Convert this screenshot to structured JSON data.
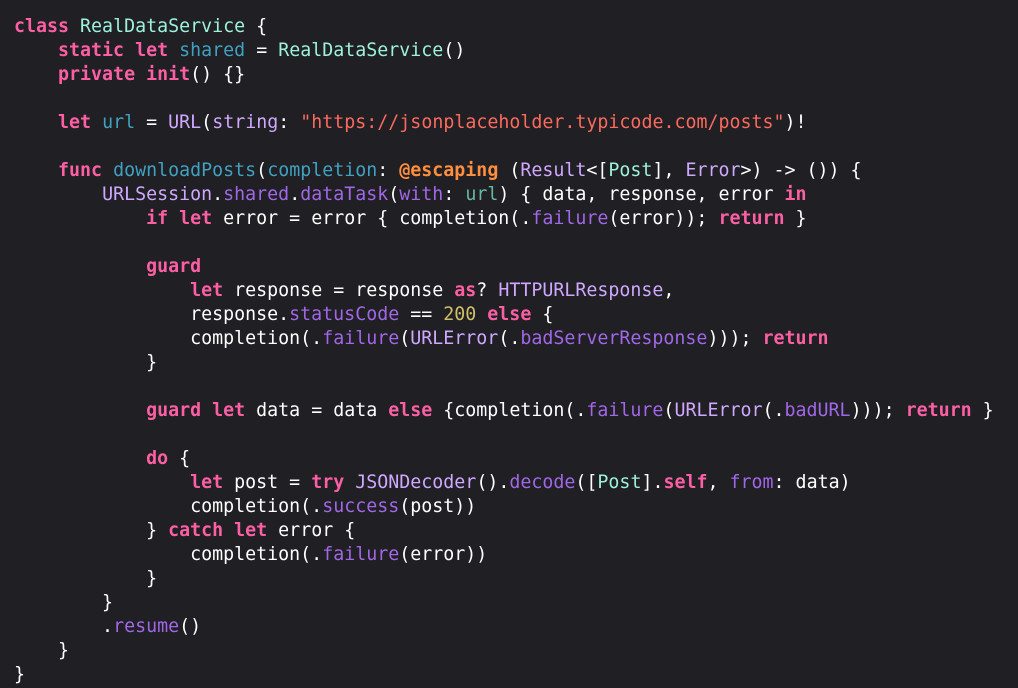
{
  "theme": {
    "background": "#1f1f24",
    "plain": "#ffffff",
    "keyword": "#fc5fa3",
    "string": "#fc6a5d",
    "number": "#d0bf69",
    "type_name": "#d0a8ff",
    "declaration": "#41a1c0",
    "project_member": "#a167e6",
    "class_name": "#9ef1dd",
    "attribute": "#fd8f3f"
  },
  "code_lines": [
    [
      [
        "kw",
        "class"
      ],
      [
        "pl",
        " "
      ],
      [
        "clsname",
        "RealDataService"
      ],
      [
        "pl",
        " {"
      ]
    ],
    [
      [
        "pl",
        "    "
      ],
      [
        "kw",
        "static"
      ],
      [
        "pl",
        " "
      ],
      [
        "kw",
        "let"
      ],
      [
        "pl",
        " "
      ],
      [
        "decl",
        "shared"
      ],
      [
        "pl",
        " = "
      ],
      [
        "clsname",
        "RealDataService"
      ],
      [
        "pl",
        "()"
      ]
    ],
    [
      [
        "pl",
        "    "
      ],
      [
        "kw",
        "private"
      ],
      [
        "pl",
        " "
      ],
      [
        "kw",
        "init"
      ],
      [
        "pl",
        "() {}"
      ]
    ],
    [
      [
        "pl",
        ""
      ]
    ],
    [
      [
        "pl",
        "    "
      ],
      [
        "kw",
        "let"
      ],
      [
        "pl",
        " "
      ],
      [
        "decl",
        "url"
      ],
      [
        "pl",
        " = "
      ],
      [
        "typ",
        "URL"
      ],
      [
        "pl",
        "("
      ],
      [
        "typ",
        "string"
      ],
      [
        "pl",
        ": "
      ],
      [
        "str",
        "\"https://jsonplaceholder.typicode.com/posts\""
      ],
      [
        "pl",
        ")!"
      ]
    ],
    [
      [
        "pl",
        ""
      ]
    ],
    [
      [
        "pl",
        "    "
      ],
      [
        "kw",
        "func"
      ],
      [
        "pl",
        " "
      ],
      [
        "decl",
        "downloadPosts"
      ],
      [
        "pl",
        "("
      ],
      [
        "decl",
        "completion"
      ],
      [
        "pl",
        ": "
      ],
      [
        "attr",
        "@escaping"
      ],
      [
        "pl",
        " ("
      ],
      [
        "typ",
        "Result"
      ],
      [
        "pl",
        "<["
      ],
      [
        "clsname",
        "Post"
      ],
      [
        "pl",
        "], "
      ],
      [
        "typ",
        "Error"
      ],
      [
        "pl",
        ">) -> ()) {"
      ]
    ],
    [
      [
        "pl",
        "        "
      ],
      [
        "typ",
        "URLSession"
      ],
      [
        "pl",
        "."
      ],
      [
        "prj",
        "shared"
      ],
      [
        "pl",
        "."
      ],
      [
        "prj",
        "dataTask"
      ],
      [
        "pl",
        "("
      ],
      [
        "prj",
        "with"
      ],
      [
        "pl",
        ": "
      ],
      [
        "prjv",
        "url"
      ],
      [
        "pl",
        ") { data, response, error "
      ],
      [
        "kw",
        "in"
      ]
    ],
    [
      [
        "pl",
        "            "
      ],
      [
        "kw",
        "if"
      ],
      [
        "pl",
        " "
      ],
      [
        "kw",
        "let"
      ],
      [
        "pl",
        " error = error { completion(."
      ],
      [
        "prj",
        "failure"
      ],
      [
        "pl",
        "(error)); "
      ],
      [
        "kw",
        "return"
      ],
      [
        "pl",
        " }"
      ]
    ],
    [
      [
        "pl",
        ""
      ]
    ],
    [
      [
        "pl",
        "            "
      ],
      [
        "kw",
        "guard"
      ]
    ],
    [
      [
        "pl",
        "                "
      ],
      [
        "kw",
        "let"
      ],
      [
        "pl",
        " response = response "
      ],
      [
        "kw",
        "as"
      ],
      [
        "pl",
        "? "
      ],
      [
        "typ",
        "HTTPURLResponse"
      ],
      [
        "pl",
        ","
      ]
    ],
    [
      [
        "pl",
        "                response."
      ],
      [
        "prj",
        "statusCode"
      ],
      [
        "pl",
        " == "
      ],
      [
        "num",
        "200"
      ],
      [
        "pl",
        " "
      ],
      [
        "kw",
        "else"
      ],
      [
        "pl",
        " {"
      ]
    ],
    [
      [
        "pl",
        "                completion(."
      ],
      [
        "prj",
        "failure"
      ],
      [
        "pl",
        "("
      ],
      [
        "typ",
        "URLError"
      ],
      [
        "pl",
        "(."
      ],
      [
        "prj",
        "badServerResponse"
      ],
      [
        "pl",
        "))); "
      ],
      [
        "kw",
        "return"
      ]
    ],
    [
      [
        "pl",
        "            }"
      ]
    ],
    [
      [
        "pl",
        ""
      ]
    ],
    [
      [
        "pl",
        "            "
      ],
      [
        "kw",
        "guard"
      ],
      [
        "pl",
        " "
      ],
      [
        "kw",
        "let"
      ],
      [
        "pl",
        " data = data "
      ],
      [
        "kw",
        "else"
      ],
      [
        "pl",
        " {completion(."
      ],
      [
        "prj",
        "failure"
      ],
      [
        "pl",
        "("
      ],
      [
        "typ",
        "URLError"
      ],
      [
        "pl",
        "(."
      ],
      [
        "prj",
        "badURL"
      ],
      [
        "pl",
        "))); "
      ],
      [
        "kw",
        "return"
      ],
      [
        "pl",
        " }"
      ]
    ],
    [
      [
        "pl",
        ""
      ]
    ],
    [
      [
        "pl",
        "            "
      ],
      [
        "kw",
        "do"
      ],
      [
        "pl",
        " {"
      ]
    ],
    [
      [
        "pl",
        "                "
      ],
      [
        "kw",
        "let"
      ],
      [
        "pl",
        " post = "
      ],
      [
        "kw",
        "try"
      ],
      [
        "pl",
        " "
      ],
      [
        "typ",
        "JSONDecoder"
      ],
      [
        "pl",
        "()."
      ],
      [
        "prj",
        "decode"
      ],
      [
        "pl",
        "(["
      ],
      [
        "clsname",
        "Post"
      ],
      [
        "pl",
        "]."
      ],
      [
        "kw",
        "self"
      ],
      [
        "pl",
        ", "
      ],
      [
        "prj",
        "from"
      ],
      [
        "pl",
        ": data)"
      ]
    ],
    [
      [
        "pl",
        "                completion(."
      ],
      [
        "prj",
        "success"
      ],
      [
        "pl",
        "(post))"
      ]
    ],
    [
      [
        "pl",
        "            } "
      ],
      [
        "kw",
        "catch"
      ],
      [
        "pl",
        " "
      ],
      [
        "kw",
        "let"
      ],
      [
        "pl",
        " error {"
      ]
    ],
    [
      [
        "pl",
        "                completion(."
      ],
      [
        "prj",
        "failure"
      ],
      [
        "pl",
        "(error))"
      ]
    ],
    [
      [
        "pl",
        "            }"
      ]
    ],
    [
      [
        "pl",
        "        }"
      ]
    ],
    [
      [
        "pl",
        "        ."
      ],
      [
        "prj",
        "resume"
      ],
      [
        "pl",
        "()"
      ]
    ],
    [
      [
        "pl",
        "    }"
      ]
    ],
    [
      [
        "pl",
        "}"
      ]
    ]
  ]
}
